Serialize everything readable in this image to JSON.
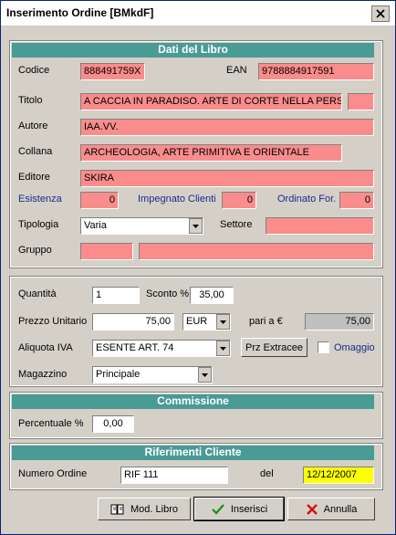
{
  "window": {
    "title": "Inserimento Ordine  [BMkdF]"
  },
  "libro": {
    "header": "Dati del Libro",
    "codice_label": "Codice",
    "codice": "888491759X",
    "ean_label": "EAN",
    "ean": "9788884917591",
    "titolo_label": "Titolo",
    "titolo": "A CACCIA IN PARADISO. ARTE DI CORTE NELLA PERS",
    "autore_label": "Autore",
    "autore": "IAA.VV.",
    "collana_label": "Collana",
    "collana": "ARCHEOLOGIA, ARTE PRIMITIVA E ORIENTALE",
    "editore_label": "Editore",
    "editore": "SKIRA",
    "esistenza_label": "Esistenza",
    "esistenza": "0",
    "impegnato_label": "Impegnato Clienti",
    "impegnato": "0",
    "ordinato_label": "Ordinato For.",
    "ordinato": "0",
    "tipologia_label": "Tipologia",
    "tipologia": "Varia",
    "settore_label": "Settore",
    "settore": "",
    "gruppo_label": "Gruppo",
    "gruppo1": "",
    "gruppo2": ""
  },
  "ordine": {
    "quantita_label": "Quantità",
    "quantita": "1",
    "sconto_label": "Sconto %",
    "sconto": "35,00",
    "prezzo_label": "Prezzo Unitario",
    "prezzo": "75,00",
    "valuta": "EUR",
    "pari_label": "pari a €",
    "pari": "75,00",
    "aliquota_label": "Aliquota IVA",
    "aliquota": "ESENTE ART. 74",
    "prz_extracee_button": "Prz Extracee",
    "omaggio_label": "Omaggio",
    "magazzino_label": "Magazzino",
    "magazzino": "Principale"
  },
  "commissione": {
    "header": "Commissione",
    "percentuale_label": "Percentuale %",
    "percentuale": "0,00"
  },
  "riferimenti": {
    "header": "Riferimenti Cliente",
    "numero_label": "Numero Ordine",
    "numero": "RIF 111",
    "del_label": "del",
    "data": "12/12/2007"
  },
  "buttons": {
    "mod_libro": "Mod. Libro",
    "inserisci": "Inserisci",
    "annulla": "Annulla"
  },
  "colors": {
    "required_field": "#fa8c8c",
    "header_teal": "#4a9a96",
    "date_field": "#ffff00"
  }
}
